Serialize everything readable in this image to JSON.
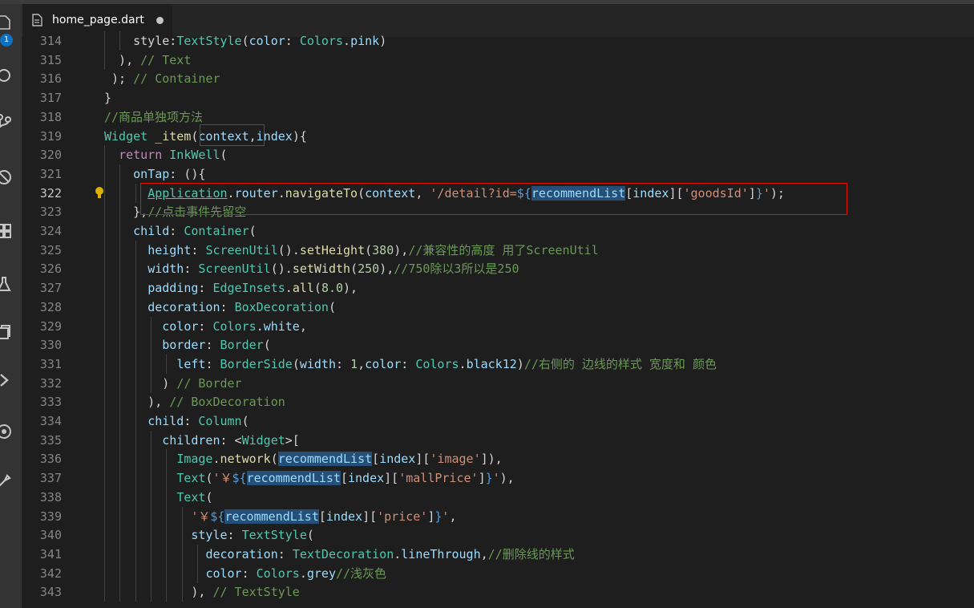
{
  "tab": {
    "title": "home_page.dart"
  },
  "activity_bar": {
    "badge": "1",
    "icons": [
      "explorer-icon",
      "search-icon",
      "source-control-icon",
      "debug-icon",
      "extensions-icon",
      "flask-icon",
      "files-icon",
      "chevron-right-icon",
      "remote-icon",
      "settings-icon"
    ]
  },
  "colors": {
    "highlight_box": "#e51400",
    "selection": "#264f78"
  },
  "lines": [
    {
      "n": "314",
      "t": [
        [
          "    style:",
          "pl"
        ],
        [
          "TextStyle",
          "ty"
        ],
        [
          "(",
          "pl"
        ],
        [
          "color",
          "va"
        ],
        [
          ": ",
          "pl"
        ],
        [
          "Colors",
          "ty"
        ],
        [
          ".",
          "pl"
        ],
        [
          "pink",
          "va"
        ],
        [
          ")",
          "pl"
        ]
      ]
    },
    {
      "n": "315",
      "t": [
        [
          "  ), ",
          "pl"
        ],
        [
          "// Text",
          "cm"
        ]
      ]
    },
    {
      "n": "316",
      "t": [
        [
          " ); ",
          "pl"
        ],
        [
          "// Container",
          "cm"
        ]
      ]
    },
    {
      "n": "317",
      "t": [
        [
          "}",
          "pl"
        ]
      ]
    },
    {
      "n": "318",
      "t": [
        [
          "//商品单独项方法",
          "cm"
        ]
      ]
    },
    {
      "n": "319",
      "t": [
        [
          "Widget",
          "ty"
        ],
        [
          " ",
          "pl"
        ],
        [
          "_item",
          "fn"
        ],
        [
          "(",
          "pl"
        ],
        [
          "context",
          "va"
        ],
        [
          ",",
          "pl"
        ],
        [
          "index",
          "va"
        ],
        [
          "){",
          "pl"
        ]
      ]
    },
    {
      "n": "320",
      "t": [
        [
          "  ",
          "pl"
        ],
        [
          "return",
          "kw"
        ],
        [
          " ",
          "pl"
        ],
        [
          "InkWell",
          "ty"
        ],
        [
          "(",
          "pl"
        ]
      ]
    },
    {
      "n": "321",
      "t": [
        [
          "    ",
          "pl"
        ],
        [
          "onTap",
          "va"
        ],
        [
          ": (){",
          "pl"
        ]
      ]
    },
    {
      "n": "322",
      "t": [
        [
          "      ",
          "pl"
        ],
        [
          "Application",
          "ty u"
        ],
        [
          ".",
          "pl"
        ],
        [
          "router",
          "va"
        ],
        [
          ".",
          "pl"
        ],
        [
          "navigateTo",
          "fn"
        ],
        [
          "(",
          "pl"
        ],
        [
          "context",
          "va"
        ],
        [
          ", ",
          "pl"
        ],
        [
          "'/detail?id=",
          "st"
        ],
        [
          "${",
          "bl"
        ],
        [
          "recommendList",
          "va hl"
        ],
        [
          "[",
          "pl"
        ],
        [
          "index",
          "va"
        ],
        [
          "][",
          "pl"
        ],
        [
          "'goodsId'",
          "st"
        ],
        [
          "]",
          "pl"
        ],
        [
          "}",
          "bl"
        ],
        [
          "'",
          "st"
        ],
        [
          ");",
          "pl"
        ]
      ]
    },
    {
      "n": "323",
      "t": [
        [
          "    },",
          "pl"
        ],
        [
          "//点击事件先留空",
          "cm"
        ]
      ]
    },
    {
      "n": "324",
      "t": [
        [
          "    ",
          "pl"
        ],
        [
          "child",
          "va"
        ],
        [
          ": ",
          "pl"
        ],
        [
          "Container",
          "ty"
        ],
        [
          "(",
          "pl"
        ]
      ]
    },
    {
      "n": "325",
      "t": [
        [
          "      ",
          "pl"
        ],
        [
          "height",
          "va"
        ],
        [
          ": ",
          "pl"
        ],
        [
          "ScreenUtil",
          "ty"
        ],
        [
          "().",
          "pl"
        ],
        [
          "setHeight",
          "fn"
        ],
        [
          "(",
          "pl"
        ],
        [
          "380",
          "nu"
        ],
        [
          "),",
          "pl"
        ],
        [
          "//兼容性的高度 用了ScreenUtil",
          "cm"
        ]
      ]
    },
    {
      "n": "326",
      "t": [
        [
          "      ",
          "pl"
        ],
        [
          "width",
          "va"
        ],
        [
          ": ",
          "pl"
        ],
        [
          "ScreenUtil",
          "ty"
        ],
        [
          "().",
          "pl"
        ],
        [
          "setWidth",
          "fn"
        ],
        [
          "(",
          "pl"
        ],
        [
          "250",
          "nu"
        ],
        [
          "),",
          "pl"
        ],
        [
          "//750除以3所以是250",
          "cm"
        ]
      ]
    },
    {
      "n": "327",
      "t": [
        [
          "      ",
          "pl"
        ],
        [
          "padding",
          "va"
        ],
        [
          ": ",
          "pl"
        ],
        [
          "EdgeInsets",
          "ty"
        ],
        [
          ".",
          "pl"
        ],
        [
          "all",
          "fn"
        ],
        [
          "(",
          "pl"
        ],
        [
          "8.0",
          "nu"
        ],
        [
          "),",
          "pl"
        ]
      ]
    },
    {
      "n": "328",
      "t": [
        [
          "      ",
          "pl"
        ],
        [
          "decoration",
          "va"
        ],
        [
          ": ",
          "pl"
        ],
        [
          "BoxDecoration",
          "ty"
        ],
        [
          "(",
          "pl"
        ]
      ]
    },
    {
      "n": "329",
      "t": [
        [
          "        ",
          "pl"
        ],
        [
          "color",
          "va"
        ],
        [
          ": ",
          "pl"
        ],
        [
          "Colors",
          "ty"
        ],
        [
          ".",
          "pl"
        ],
        [
          "white",
          "va"
        ],
        [
          ",",
          "pl"
        ]
      ]
    },
    {
      "n": "330",
      "t": [
        [
          "        ",
          "pl"
        ],
        [
          "border",
          "va"
        ],
        [
          ": ",
          "pl"
        ],
        [
          "Border",
          "ty"
        ],
        [
          "(",
          "pl"
        ]
      ]
    },
    {
      "n": "331",
      "t": [
        [
          "          ",
          "pl"
        ],
        [
          "left",
          "va"
        ],
        [
          ": ",
          "pl"
        ],
        [
          "BorderSide",
          "ty"
        ],
        [
          "(",
          "pl"
        ],
        [
          "width",
          "va"
        ],
        [
          ": ",
          "pl"
        ],
        [
          "1",
          "nu"
        ],
        [
          ",",
          "pl"
        ],
        [
          "color",
          "va"
        ],
        [
          ": ",
          "pl"
        ],
        [
          "Colors",
          "ty"
        ],
        [
          ".",
          "pl"
        ],
        [
          "black12",
          "va"
        ],
        [
          ")",
          "pl"
        ],
        [
          "//右侧的 边线的样式 宽度和 颜色",
          "cm"
        ]
      ]
    },
    {
      "n": "332",
      "t": [
        [
          "        ) ",
          "pl"
        ],
        [
          "// Border",
          "cm"
        ]
      ]
    },
    {
      "n": "333",
      "t": [
        [
          "      ), ",
          "pl"
        ],
        [
          "// BoxDecoration",
          "cm"
        ]
      ]
    },
    {
      "n": "334",
      "t": [
        [
          "      ",
          "pl"
        ],
        [
          "child",
          "va"
        ],
        [
          ": ",
          "pl"
        ],
        [
          "Column",
          "ty"
        ],
        [
          "(",
          "pl"
        ]
      ]
    },
    {
      "n": "335",
      "t": [
        [
          "        ",
          "pl"
        ],
        [
          "children",
          "va"
        ],
        [
          ": <",
          "pl"
        ],
        [
          "Widget",
          "ty"
        ],
        [
          ">[",
          "pl"
        ]
      ]
    },
    {
      "n": "336",
      "t": [
        [
          "          ",
          "pl"
        ],
        [
          "Image",
          "ty"
        ],
        [
          ".",
          "pl"
        ],
        [
          "network",
          "fn"
        ],
        [
          "(",
          "pl"
        ],
        [
          "recommendList",
          "va hl"
        ],
        [
          "[",
          "pl"
        ],
        [
          "index",
          "va"
        ],
        [
          "][",
          "pl"
        ],
        [
          "'image'",
          "st"
        ],
        [
          "]),",
          "pl"
        ]
      ]
    },
    {
      "n": "337",
      "t": [
        [
          "          ",
          "pl"
        ],
        [
          "Text",
          "ty"
        ],
        [
          "(",
          "pl"
        ],
        [
          "'￥",
          "st"
        ],
        [
          "${",
          "bl"
        ],
        [
          "recommendList",
          "va hl"
        ],
        [
          "[",
          "pl"
        ],
        [
          "index",
          "va"
        ],
        [
          "][",
          "pl"
        ],
        [
          "'mallPrice'",
          "st"
        ],
        [
          "]",
          "pl"
        ],
        [
          "}",
          "bl"
        ],
        [
          "'",
          "st"
        ],
        [
          "),",
          "pl"
        ]
      ]
    },
    {
      "n": "338",
      "t": [
        [
          "          ",
          "pl"
        ],
        [
          "Text",
          "ty"
        ],
        [
          "(",
          "pl"
        ]
      ]
    },
    {
      "n": "339",
      "t": [
        [
          "            ",
          "pl"
        ],
        [
          "'￥",
          "st"
        ],
        [
          "${",
          "bl"
        ],
        [
          "recommendList",
          "va hl"
        ],
        [
          "[",
          "pl"
        ],
        [
          "index",
          "va"
        ],
        [
          "][",
          "pl"
        ],
        [
          "'price'",
          "st"
        ],
        [
          "]",
          "pl"
        ],
        [
          "}",
          "bl"
        ],
        [
          "'",
          "st"
        ],
        [
          ",",
          "pl"
        ]
      ]
    },
    {
      "n": "340",
      "t": [
        [
          "            ",
          "pl"
        ],
        [
          "style",
          "va"
        ],
        [
          ": ",
          "pl"
        ],
        [
          "TextStyle",
          "ty"
        ],
        [
          "(",
          "pl"
        ]
      ]
    },
    {
      "n": "341",
      "t": [
        [
          "              ",
          "pl"
        ],
        [
          "decoration",
          "va"
        ],
        [
          ": ",
          "pl"
        ],
        [
          "TextDecoration",
          "ty"
        ],
        [
          ".",
          "pl"
        ],
        [
          "lineThrough",
          "va"
        ],
        [
          ",",
          "pl"
        ],
        [
          "//删除线的样式",
          "cm"
        ]
      ]
    },
    {
      "n": "342",
      "t": [
        [
          "              ",
          "pl"
        ],
        [
          "color",
          "va"
        ],
        [
          ": ",
          "pl"
        ],
        [
          "Colors",
          "ty"
        ],
        [
          ".",
          "pl"
        ],
        [
          "grey",
          "va"
        ],
        [
          "//浅灰色",
          "cm"
        ]
      ]
    },
    {
      "n": "343",
      "t": [
        [
          "            ), ",
          "pl"
        ],
        [
          "// TextStyle",
          "cm"
        ]
      ]
    }
  ]
}
